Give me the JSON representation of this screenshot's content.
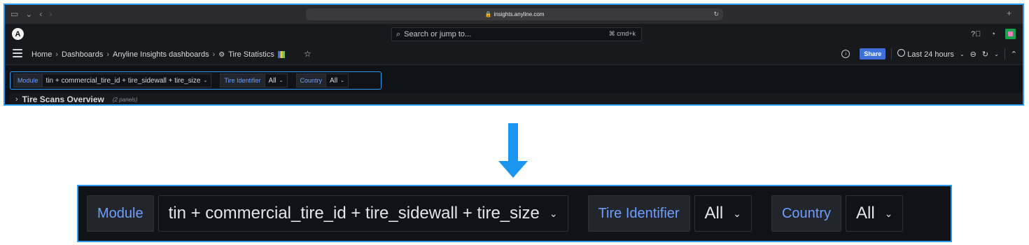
{
  "browser": {
    "url": "insights.anyline.com"
  },
  "grafana_top": {
    "logo_letter": "A",
    "search_placeholder": "Search or jump to...",
    "search_shortcut": "⌘ cmd+k"
  },
  "breadcrumbs": [
    {
      "label": "Home"
    },
    {
      "label": "Dashboards"
    },
    {
      "label": "Anyline Insights dashboards"
    },
    {
      "label": "Tire Statistics"
    }
  ],
  "toolbar": {
    "share_label": "Share",
    "time_range": "Last 24 hours"
  },
  "variables": {
    "module_label": "Module",
    "module_value": "tin + commercial_tire_id + tire_sidewall + tire_size",
    "tire_identifier_label": "Tire Identifier",
    "tire_identifier_value": "All",
    "country_label": "Country",
    "country_value": "All"
  },
  "row_panel": {
    "title": "Tire Scans Overview",
    "count": "(2 panels)"
  },
  "colors": {
    "highlight_border": "#2d9cf0",
    "arrow": "#1a96f1",
    "label_text": "#6e9fff",
    "share_button": "#3d71d9"
  }
}
